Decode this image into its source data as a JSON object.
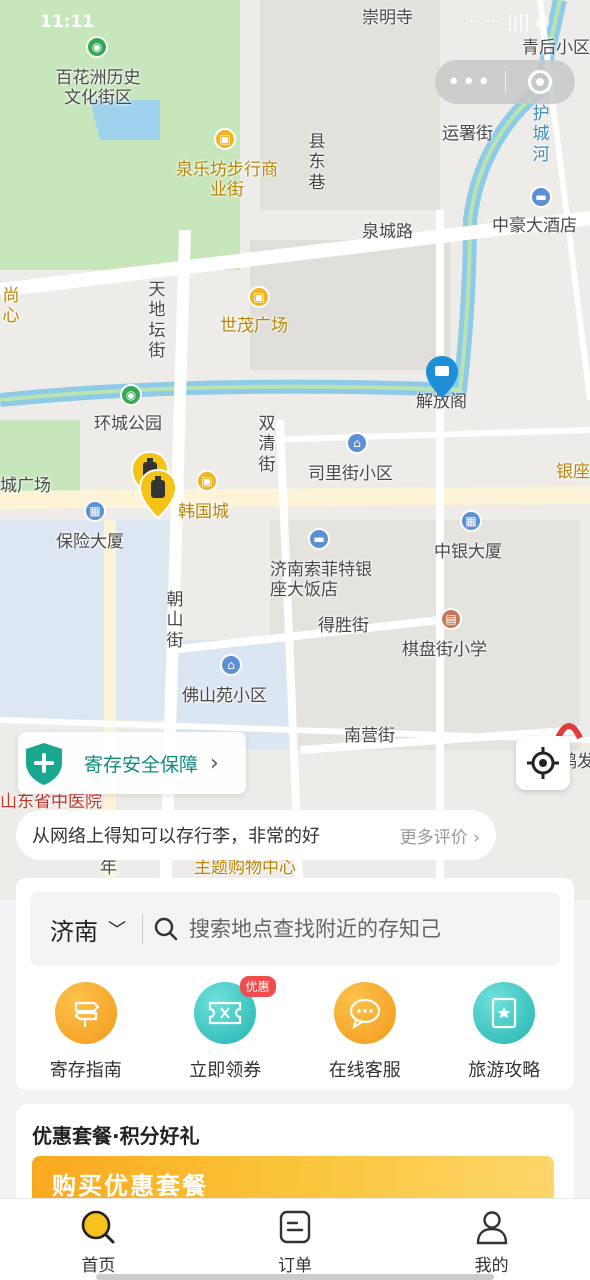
{
  "status_bar": {
    "time": "11:11",
    "signal": "·· ··· |||| ◉"
  },
  "map": {
    "labels": {
      "baihuazhou": "百花洲历史文化街区",
      "quanlefang": "泉乐坊步行商业街",
      "xiandongxiang": "县东巷",
      "yunshujie": "运署街",
      "huchenghe": "护城河",
      "qinghou": "青后小区",
      "chongming": "崇明寺",
      "zhonghao": "中豪大酒店",
      "quanchenglu": "泉城路",
      "tiandi": "天地坛街",
      "shimao": "世茂广场",
      "jiefangge": "解放阁",
      "huancheng": "环城公园",
      "shuangqing": "双清街",
      "silijie": "司里街小区",
      "hanguocheng": "韩国城",
      "baoxian": "保险大厦",
      "suofeite": "济南索菲特银座大饭店",
      "zhongyin": "中银大厦",
      "chaoshan": "朝山街",
      "desheng": "得胜街",
      "qipan": "棋盘街小学",
      "foshanyuan": "佛山苑小区",
      "nanying": "南营街",
      "zhongyiyuan": "山东省中医院",
      "shangxin": "尚心",
      "guangchang": "城广场",
      "yinzuo": "银座",
      "zhuti": "主题购物中心",
      "nian": "年",
      "hefa": "鸿发"
    }
  },
  "safety": {
    "label": "寄存安全保障"
  },
  "review": {
    "quote": "从网络上得知可以存行李，非常的好",
    "more": "更多评价 ›"
  },
  "search": {
    "city": "济南",
    "placeholder": "搜索地点查找附近的存知己"
  },
  "shortcuts": [
    {
      "label": "寄存指南",
      "icon": "signpost-icon",
      "color": "#f6a623"
    },
    {
      "label": "立即领券",
      "icon": "coupon-icon",
      "color": "#3cc8c4",
      "badge": "优惠"
    },
    {
      "label": "在线客服",
      "icon": "chat-icon",
      "color": "#f6a623"
    },
    {
      "label": "旅游攻略",
      "icon": "guidebook-icon",
      "color": "#3cc8c4"
    }
  ],
  "promo": {
    "title": "优惠套餐·积分好礼",
    "banner": "购买优惠套餐"
  },
  "tabs": [
    {
      "label": "首页",
      "icon": "home-search-icon"
    },
    {
      "label": "订单",
      "icon": "order-icon"
    },
    {
      "label": "我的",
      "icon": "profile-icon"
    }
  ],
  "colors": {
    "accent": "#f6c21b",
    "teal": "#0f8c7c",
    "water": "#5fb8e6",
    "park": "#b9e3b0"
  }
}
